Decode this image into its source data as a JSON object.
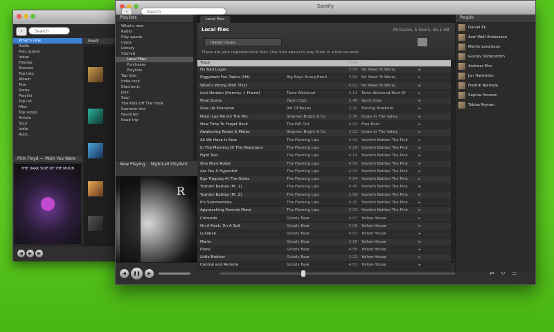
{
  "back_window": {
    "search_placeholder": "Search",
    "sidebar_items": [
      "What's new",
      "Radio",
      "Play queue",
      "Inbox",
      "Friends",
      "Starred",
      "Top lists",
      "Album",
      "Tom",
      "Some",
      "Playlist",
      "Top list",
      "Misc",
      "Top songs",
      "Artists",
      "Soul",
      "Indie",
      "Rock"
    ],
    "panel_title": "Feed",
    "now_playing": "Pink Floyd  —  Wish You Were Here",
    "album_text": "THE DARK SIDE OF THE MOON"
  },
  "main_window": {
    "title": "Spotify",
    "search_placeholder": "Search",
    "sidebar_header": "Playlists",
    "sidebar_items": [
      {
        "label": "What's new",
        "state": "normal"
      },
      {
        "label": "Radio",
        "state": "normal"
      },
      {
        "label": "Play queue",
        "state": "normal"
      },
      {
        "label": "Inbox",
        "state": "normal"
      },
      {
        "label": "Library",
        "state": "normal"
      },
      {
        "label": "Starred",
        "state": "normal"
      },
      {
        "label": "Local Files",
        "state": "selected"
      },
      {
        "label": "Purchases",
        "state": "normal"
      },
      {
        "label": "Playlists",
        "state": "normal"
      },
      {
        "label": "Top lists",
        "state": "normal"
      },
      {
        "label": "Indie rock",
        "state": "normal"
      },
      {
        "label": "Electronic",
        "state": "normal"
      },
      {
        "label": "Jazz",
        "state": "normal"
      },
      {
        "label": "Soul",
        "state": "normal"
      },
      {
        "label": "The Kids Off The Hook",
        "state": "normal"
      },
      {
        "label": "Summer mix",
        "state": "normal"
      },
      {
        "label": "Favorites",
        "state": "normal"
      },
      {
        "label": "Road trip",
        "state": "normal"
      }
    ],
    "tab_label": "Local files",
    "section_title": "Local files",
    "section_stats": "78 tracks, 5 hours, 45.1 GB",
    "import_button": "Import music",
    "import_info": "These are your imported local files. Use links above to play them in a few seconds.",
    "track_table": {
      "headers": [
        "Track",
        "Artist",
        "Time",
        "Album",
        ""
      ],
      "rows": [
        [
          "Fix Bad Logan",
          "",
          "3:15",
          "No Need To Worry"
        ],
        [
          "Piggyback Fun Topics (Hit)",
          "Big Boys Young Band",
          "3:50",
          "No Need To Worry"
        ],
        [
          "What's Wrong With This?",
          "",
          "4:02",
          "No Need To Worry"
        ],
        [
          "Lost Horizon (Hammy + Friend)",
          "Tame Weekend",
          "4:12",
          "Tame Weekend Best Of"
        ],
        [
          "Final Scene",
          "Yacht Club",
          "3:48",
          "Yacht Club"
        ],
        [
          "Give Up Everyone",
          "Jim Of Beans",
          "3:20",
          "Moving Nowhere"
        ],
        [
          "Moon Lay Me On The Mic",
          "Stephen Bright & Co",
          "3:36",
          "Down In The Valley"
        ],
        [
          "How Time To Forget Rock",
          "The Fall Out",
          "4:10",
          "Free Burn"
        ],
        [
          "Awakening Roses & Mates",
          "Stephen Bright & Co",
          "3:22",
          "Down In The Valley"
        ],
        [
          "All We Have Is Now",
          "The Flaming Lips",
          "4:41",
          "Yoshimi Battles The Pink"
        ],
        [
          "In The Morning Of The Magicians",
          "The Flaming Lips",
          "6:18",
          "Yoshimi Battles The Pink"
        ],
        [
          "Fight Test",
          "The Flaming Lips",
          "4:14",
          "Yoshimi Battles The Pink"
        ],
        [
          "One More Robot",
          "The Flaming Lips",
          "4:59",
          "Yoshimi Battles The Pink"
        ],
        [
          "Are You A Hypnotist",
          "The Flaming Lips",
          "4:43",
          "Yoshimi Battles The Pink"
        ],
        [
          "Ego Tripping At The Gates",
          "The Flaming Lips",
          "4:54",
          "Yoshimi Battles The Pink"
        ],
        [
          "Yoshimi Battles (Pt. 1)",
          "The Flaming Lips",
          "4:45",
          "Yoshimi Battles The Pink"
        ],
        [
          "Yoshimi Battles (Pt. 2)",
          "The Flaming Lips",
          "2:58",
          "Yoshimi Battles The Pink"
        ],
        [
          "It's Summertime",
          "The Flaming Lips",
          "4:20",
          "Yoshimi Battles The Pink"
        ],
        [
          "Approaching Pavonis Mons",
          "The Flaming Lips",
          "3:33",
          "Yoshimi Battles The Pink"
        ],
        [
          "Colorado",
          "Grizzly Bear",
          "4:07",
          "Yellow House"
        ],
        [
          "On A Neck, On A Spit",
          "Grizzly Bear",
          "5:08",
          "Yellow House"
        ],
        [
          "Lullabye",
          "Grizzly Bear",
          "4:52",
          "Yellow House"
        ],
        [
          "Marla",
          "Grizzly Bear",
          "3:16",
          "Yellow House"
        ],
        [
          "Plans",
          "Grizzly Bear",
          "4:58",
          "Yellow House"
        ],
        [
          "Little Brother",
          "Grizzly Bear",
          "3:22",
          "Yellow House"
        ],
        [
          "Central and Remote",
          "Grizzly Bear",
          "4:01",
          "Yellow House"
        ]
      ]
    },
    "people_header": "People",
    "people": [
      "Daniel Ek",
      "Axel Wolf Andersson",
      "Martin Lorentzon",
      "Gustav Söderström",
      "Andreas Ehn",
      "Jon Hallström",
      "Fredrik Niemelä",
      "Sophia Persson",
      "Tobias Nyman"
    ],
    "now_playing_label": "Now Playing",
    "now_playing_track": "Nightcall (Stylish)",
    "album_corner_text": "R"
  }
}
